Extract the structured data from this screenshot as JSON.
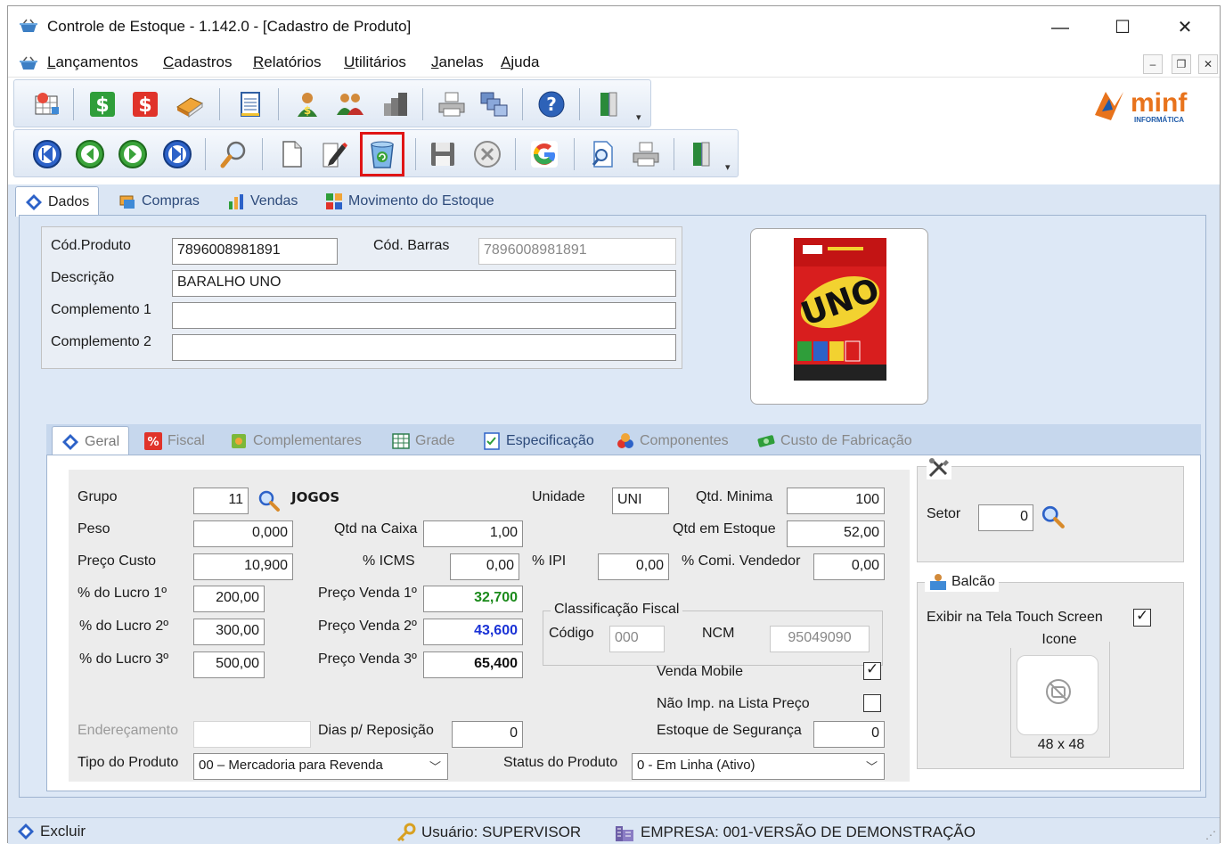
{
  "window": {
    "title": "Controle de Estoque - 1.142.0 - [Cadastro de Produto]",
    "min_glyph": "—",
    "max_glyph": "☐",
    "close_glyph": "✕"
  },
  "menu": [
    {
      "key": "L",
      "rest": "ançamentos"
    },
    {
      "key": "C",
      "rest": "adastros"
    },
    {
      "key": "R",
      "rest": "elatórios"
    },
    {
      "key": "U",
      "rest": "tilitários"
    },
    {
      "key": "J",
      "rest": "anelas"
    },
    {
      "key": "A",
      "rest": "juda"
    }
  ],
  "mdi_controls": {
    "min": "–",
    "restore": "❐",
    "close": "✕"
  },
  "logo": {
    "text": "minf",
    "sub": "INFORMÁTICA",
    "color": "#e8731c"
  },
  "main_tabs": [
    "Dados",
    "Compras",
    "Vendas",
    "Movimento do Estoque"
  ],
  "header": {
    "cod_produto_label": "Cód.Produto",
    "cod_produto": "7896008981891",
    "cod_barras_label": "Cód. Barras",
    "cod_barras": "7896008981891",
    "descricao_label": "Descrição",
    "descricao": "BARALHO UNO",
    "comp1_label": "Complemento 1",
    "comp1": "",
    "comp2_label": "Complemento 2",
    "comp2": ""
  },
  "product_image": {
    "brand": "UNO"
  },
  "inner_tabs": [
    "Geral",
    "Fiscal",
    "Complementares",
    "Grade",
    "Especificação",
    "Componentes",
    "Custo de Fabricação"
  ],
  "geral": {
    "grupo_label": "Grupo",
    "grupo": "11",
    "grupo_name": "JOGOS",
    "unidade_label": "Unidade",
    "unidade": "UNI",
    "qtd_minima_label": "Qtd. Minima",
    "qtd_minima": "100",
    "peso_label": "Peso",
    "peso": "0,000",
    "qtd_caixa_label": "Qtd na Caixa",
    "qtd_caixa": "1,00",
    "qtd_estoque_label": "Qtd em Estoque",
    "qtd_estoque": "52,00",
    "preco_custo_label": "Preço Custo",
    "preco_custo": "10,900",
    "icms_label": "% ICMS",
    "icms": "0,00",
    "ipi_label": "% IPI",
    "ipi": "0,00",
    "comi_label": "% Comi. Vendedor",
    "comi": "0,00",
    "lucro1_label": "% do Lucro 1º",
    "lucro1": "200,00",
    "lucro2_label": "% do Lucro 2º",
    "lucro2": "300,00",
    "lucro3_label": "% do Lucro 3º",
    "lucro3": "500,00",
    "pv1_label": "Preço Venda 1º",
    "pv1": "32,700",
    "pv2_label": "Preço Venda 2º",
    "pv2": "43,600",
    "pv3_label": "Preço Venda 3º",
    "pv3": "65,400",
    "class_fiscal_label": "Classificação Fiscal",
    "codigo_label": "Código",
    "codigo": "000",
    "ncm_label": "NCM",
    "ncm": "95049090",
    "venda_mobile_label": "Venda Mobile",
    "venda_mobile_checked": true,
    "nao_imp_label": "Não Imp. na Lista Preço",
    "nao_imp_checked": false,
    "enderecamento_label": "Endereçamento",
    "enderecamento": "",
    "dias_rep_label": "Dias p/ Reposição",
    "dias_rep": "0",
    "estoque_seg_label": "Estoque de Segurança",
    "estoque_seg": "0",
    "tipo_label": "Tipo do Produto",
    "tipo": "00 – Mercadoria para Revenda",
    "status_label": "Status do Produto",
    "status": "0 - Em Linha (Ativo)"
  },
  "side": {
    "setor_label": "Setor",
    "setor": "0",
    "balcao_label": "Balcão",
    "touch_label": "Exibir na Tela Touch Screen",
    "touch_checked": true,
    "icone_label": "Icone",
    "icone_size": "48 x 48"
  },
  "statusbar": {
    "excluir": "Excluir",
    "usuario": "Usuário: SUPERVISOR",
    "empresa": "EMPRESA: 001-VERSÃO DE DEMONSTRAÇÃO"
  },
  "colors": {
    "accent": "#2d4a7a",
    "green_price": "#1b8a1b",
    "blue_price": "#1a32d6",
    "highlight": "#e01515"
  }
}
